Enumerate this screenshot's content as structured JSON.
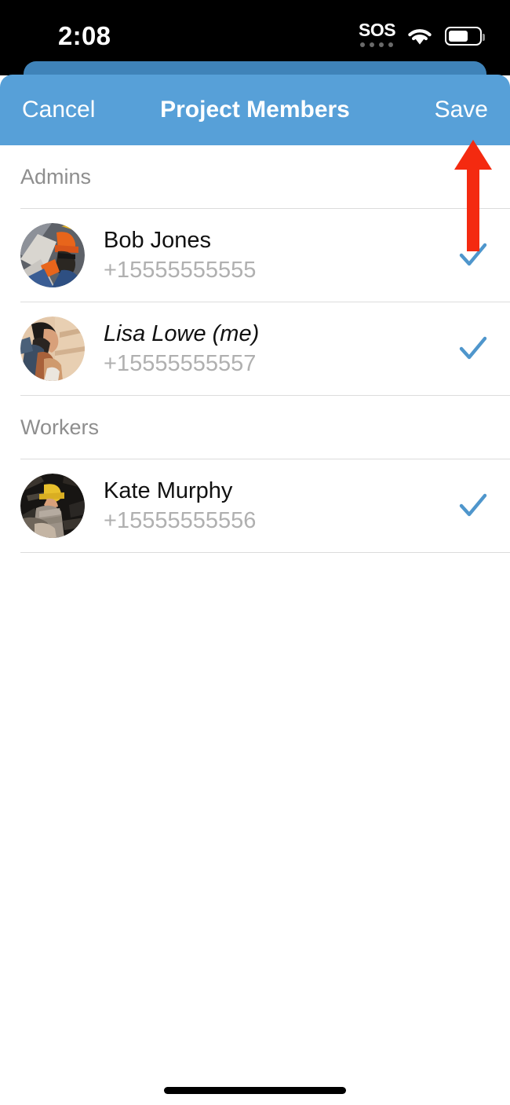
{
  "status_bar": {
    "time": "2:08",
    "sos_label": "SOS",
    "wifi_icon": "wifi-icon",
    "battery_icon": "battery-icon"
  },
  "navbar": {
    "cancel_label": "Cancel",
    "title": "Project Members",
    "save_label": "Save",
    "background_color": "#57a0d8",
    "text_color": "#ffffff"
  },
  "annotation": {
    "arrow_icon": "up-arrow-annotation",
    "color": "#f42a10",
    "points_to": "Save"
  },
  "list": {
    "sections": [
      {
        "header": "Admins",
        "rows": [
          {
            "name": "Bob Jones",
            "phone": "+15555555555",
            "avatar": "construction-worker-orange-helmet-avatar",
            "selected": true,
            "is_me": false,
            "check_icon": "checkmark-icon"
          },
          {
            "name": "Lisa Lowe (me)",
            "phone": "+15555555557",
            "avatar": "person-warm-background-avatar",
            "selected": true,
            "is_me": true,
            "check_icon": "checkmark-icon"
          }
        ]
      },
      {
        "header": "Workers",
        "rows": [
          {
            "name": "Kate Murphy",
            "phone": "+15555555556",
            "avatar": "construction-worker-yellow-helmet-avatar",
            "selected": true,
            "is_me": false,
            "check_icon": "checkmark-icon"
          }
        ]
      }
    ],
    "checkmark_color": "#4f96cc",
    "separator_color": "#dcdcdc",
    "section_header_color": "#8e8e8e",
    "name_color": "#111111",
    "phone_color": "#b0b0b0"
  },
  "home_indicator": {
    "icon": "home-indicator"
  }
}
